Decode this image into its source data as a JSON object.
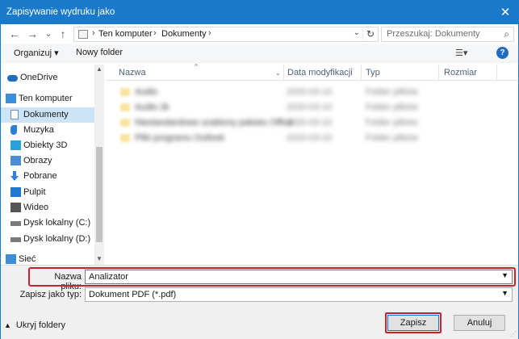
{
  "window": {
    "title": "Zapisywanie wydruku jako",
    "close_glyph": "✕"
  },
  "nav": {
    "back_glyph": "←",
    "forward_glyph": "→",
    "history_glyph": "⌄",
    "up_glyph": "↑"
  },
  "address": {
    "segments": [
      "Ten komputer",
      "Dokumenty"
    ],
    "separator": "›",
    "dropdown_glyph": "⌄",
    "refresh_glyph": "↻"
  },
  "search": {
    "placeholder": "Przeszukaj: Dokumenty",
    "icon_glyph": "⌕"
  },
  "toolbar": {
    "organize_label": "Organizuj ▾",
    "new_folder_label": "Nowy folder",
    "view_label": "☰▾",
    "help_label": "?"
  },
  "sidebar": {
    "items": [
      {
        "label": "OneDrive",
        "icon": "cloud-icon",
        "color": "#1f6ac3"
      },
      {
        "label": "Ten komputer",
        "icon": "computer-icon",
        "color": "#3b8ed8"
      },
      {
        "label": "Dokumenty",
        "icon": "document-icon",
        "color": "#6f8fb5",
        "selected": true
      },
      {
        "label": "Muzyka",
        "icon": "music-icon",
        "color": "#2a7fd4"
      },
      {
        "label": "Obiekty 3D",
        "icon": "cube-icon",
        "color": "#2ba1d9"
      },
      {
        "label": "Obrazy",
        "icon": "picture-icon",
        "color": "#4a8fd1"
      },
      {
        "label": "Pobrane",
        "icon": "download-icon",
        "color": "#2f7ed8"
      },
      {
        "label": "Pulpit",
        "icon": "desktop-icon",
        "color": "#1f78d1"
      },
      {
        "label": "Wideo",
        "icon": "video-icon",
        "color": "#555555"
      },
      {
        "label": "Dysk lokalny (C:)",
        "icon": "drive-icon",
        "color": "#7a7a7a"
      },
      {
        "label": "Dysk lokalny (D:)",
        "icon": "drive-icon",
        "color": "#7a7a7a"
      },
      {
        "label": "Sieć",
        "icon": "network-icon",
        "color": "#3b8ed8"
      }
    ]
  },
  "columns": {
    "name": "Nazwa",
    "date": "Data modyfikacji",
    "type": "Typ",
    "size": "Rozmiar",
    "sort_glyph": "^"
  },
  "files": [
    {
      "name": "Audio",
      "date": "2020-03-10",
      "type": "Folder plików"
    },
    {
      "name": "Audio 2k",
      "date": "2020-03-10",
      "type": "Folder plików"
    },
    {
      "name": "Niestandardowe szablony pakietu Office",
      "date": "2020-03-10",
      "type": "Folder plików"
    },
    {
      "name": "Pliki programu Outlook",
      "date": "2020-03-10",
      "type": "Folder plików"
    }
  ],
  "footer": {
    "filename_label": "Nazwa pliku:",
    "filename_value": "Analizator",
    "filetype_label": "Zapisz jako typ:",
    "filetype_value": "Dokument PDF (*.pdf)",
    "dropdown_glyph": "▼",
    "hide_folders_label": "Ukryj foldery",
    "hide_caret": "▲",
    "save_label": "Zapisz",
    "cancel_label": "Anuluj"
  },
  "colors": {
    "titlebar": "#1979ca",
    "selection": "#cce4f7",
    "highlight": "#c8232c"
  }
}
